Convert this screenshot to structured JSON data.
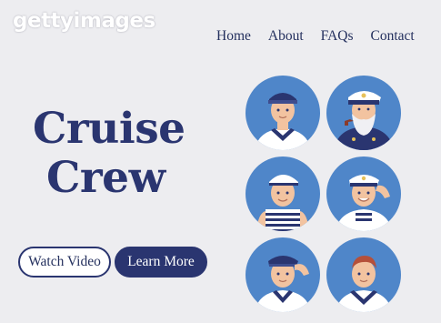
{
  "watermark": "gettyimages",
  "nav": [
    "Home",
    "About",
    "FAQs",
    "Contact"
  ],
  "hero": {
    "line1": "Cruise",
    "line2": "Crew"
  },
  "buttons": {
    "watch": "Watch Video",
    "learn": "Learn More"
  },
  "colors": {
    "navy": "#2a3570",
    "avatar_bg": "#4f86c9",
    "page_bg": "#ededf0",
    "skin": "#f2c3a0"
  },
  "avatars": [
    "sailor-blue-cap-icon",
    "captain-with-pipe-icon",
    "sailor-striped-shirt-icon",
    "officer-saluting-icon",
    "sailor-saluting-icon",
    "sailor-redhead-icon"
  ]
}
